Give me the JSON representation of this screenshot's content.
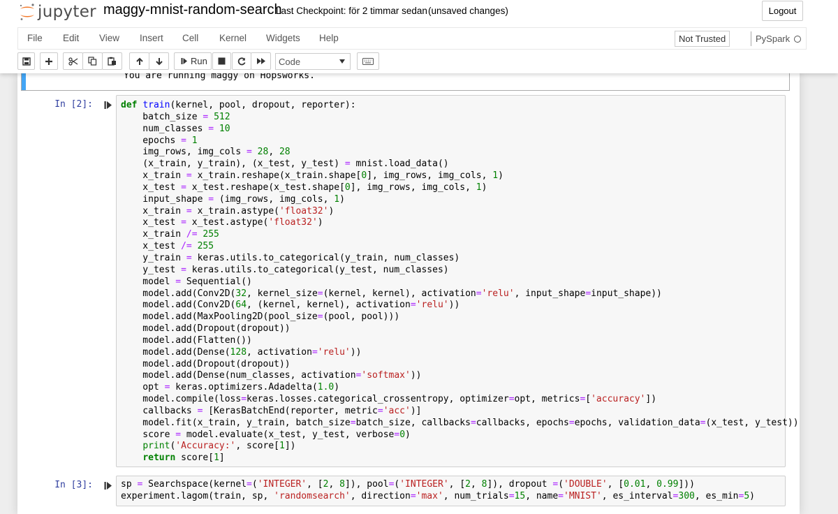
{
  "app": {
    "logo_text": "jupyter",
    "notebook_title": "maggy-mnist-random-search",
    "checkpoint": "Last Checkpoint: för 2 timmar sedan",
    "save_status": "(unsaved changes)",
    "logout_label": "Logout"
  },
  "menu": {
    "items": [
      "File",
      "Edit",
      "View",
      "Insert",
      "Cell",
      "Kernel",
      "Widgets",
      "Help"
    ],
    "trust_label": "Not Trusted",
    "kernel_name": "PySpark"
  },
  "toolbar": {
    "run_label": "Run",
    "cell_type": "Code",
    "icons": [
      "save-icon",
      "plus-icon",
      "cut-icon",
      "copy-icon",
      "paste-icon",
      "arrow-up-icon",
      "arrow-down-icon",
      "step-forward-icon",
      "stop-icon",
      "restart-icon",
      "fast-forward-icon",
      "keyboard-icon"
    ]
  },
  "colors": {
    "prompt": "#303f9f",
    "keyword": "#008000",
    "string": "#ba2121",
    "operator": "#aa22ff",
    "function_name": "#0000ff",
    "selected_cell_bar": "#42a5f5"
  },
  "cells": {
    "prev_output": "You are running maggy on Hopsworks.",
    "cell2": {
      "prompt": "In [2]:",
      "lines": [
        [
          [
            "kw",
            "def"
          ],
          [
            "t",
            " "
          ],
          [
            "fn",
            "train"
          ],
          [
            "t",
            "(kernel, pool, dropout, reporter):"
          ]
        ],
        [
          [
            "t",
            "    batch_size "
          ],
          [
            "op",
            "="
          ],
          [
            "t",
            " "
          ],
          [
            "num",
            "512"
          ]
        ],
        [
          [
            "t",
            "    num_classes "
          ],
          [
            "op",
            "="
          ],
          [
            "t",
            " "
          ],
          [
            "num",
            "10"
          ]
        ],
        [
          [
            "t",
            "    epochs "
          ],
          [
            "op",
            "="
          ],
          [
            "t",
            " "
          ],
          [
            "num",
            "1"
          ]
        ],
        [
          [
            "t",
            "    img_rows, img_cols "
          ],
          [
            "op",
            "="
          ],
          [
            "t",
            " "
          ],
          [
            "num",
            "28"
          ],
          [
            "t",
            ", "
          ],
          [
            "num",
            "28"
          ]
        ],
        [
          [
            "t",
            "    (x_train, y_train), (x_test, y_test) "
          ],
          [
            "op",
            "="
          ],
          [
            "t",
            " mnist.load_data()"
          ]
        ],
        [
          [
            "t",
            "    x_train "
          ],
          [
            "op",
            "="
          ],
          [
            "t",
            " x_train.reshape(x_train.shape["
          ],
          [
            "num",
            "0"
          ],
          [
            "t",
            "], img_rows, img_cols, "
          ],
          [
            "num",
            "1"
          ],
          [
            "t",
            ")"
          ]
        ],
        [
          [
            "t",
            "    x_test "
          ],
          [
            "op",
            "="
          ],
          [
            "t",
            " x_test.reshape(x_test.shape["
          ],
          [
            "num",
            "0"
          ],
          [
            "t",
            "], img_rows, img_cols, "
          ],
          [
            "num",
            "1"
          ],
          [
            "t",
            ")"
          ]
        ],
        [
          [
            "t",
            "    input_shape "
          ],
          [
            "op",
            "="
          ],
          [
            "t",
            " (img_rows, img_cols, "
          ],
          [
            "num",
            "1"
          ],
          [
            "t",
            ")"
          ]
        ],
        [
          [
            "t",
            "    x_train "
          ],
          [
            "op",
            "="
          ],
          [
            "t",
            " x_train.astype("
          ],
          [
            "str",
            "'float32'"
          ],
          [
            "t",
            ")"
          ]
        ],
        [
          [
            "t",
            "    x_test "
          ],
          [
            "op",
            "="
          ],
          [
            "t",
            " x_test.astype("
          ],
          [
            "str",
            "'float32'"
          ],
          [
            "t",
            ")"
          ]
        ],
        [
          [
            "t",
            "    x_train "
          ],
          [
            "op",
            "/="
          ],
          [
            "t",
            " "
          ],
          [
            "num",
            "255"
          ]
        ],
        [
          [
            "t",
            "    x_test "
          ],
          [
            "op",
            "/="
          ],
          [
            "t",
            " "
          ],
          [
            "num",
            "255"
          ]
        ],
        [
          [
            "t",
            "    y_train "
          ],
          [
            "op",
            "="
          ],
          [
            "t",
            " keras.utils.to_categorical(y_train, num_classes)"
          ]
        ],
        [
          [
            "t",
            "    y_test "
          ],
          [
            "op",
            "="
          ],
          [
            "t",
            " keras.utils.to_categorical(y_test, num_classes)"
          ]
        ],
        [
          [
            "t",
            "    model "
          ],
          [
            "op",
            "="
          ],
          [
            "t",
            " Sequential()"
          ]
        ],
        [
          [
            "t",
            "    model.add(Conv2D("
          ],
          [
            "num",
            "32"
          ],
          [
            "t",
            ", kernel_size"
          ],
          [
            "op",
            "="
          ],
          [
            "t",
            "(kernel, kernel), activation"
          ],
          [
            "op",
            "="
          ],
          [
            "str",
            "'relu'"
          ],
          [
            "t",
            ", input_shape"
          ],
          [
            "op",
            "="
          ],
          [
            "t",
            "input_shape))"
          ]
        ],
        [
          [
            "t",
            "    model.add(Conv2D("
          ],
          [
            "num",
            "64"
          ],
          [
            "t",
            ", (kernel, kernel), activation"
          ],
          [
            "op",
            "="
          ],
          [
            "str",
            "'relu'"
          ],
          [
            "t",
            "))"
          ]
        ],
        [
          [
            "t",
            "    model.add(MaxPooling2D(pool_size"
          ],
          [
            "op",
            "="
          ],
          [
            "t",
            "(pool, pool)))"
          ]
        ],
        [
          [
            "t",
            "    model.add(Dropout(dropout))"
          ]
        ],
        [
          [
            "t",
            "    model.add(Flatten())"
          ]
        ],
        [
          [
            "t",
            "    model.add(Dense("
          ],
          [
            "num",
            "128"
          ],
          [
            "t",
            ", activation"
          ],
          [
            "op",
            "="
          ],
          [
            "str",
            "'relu'"
          ],
          [
            "t",
            "))"
          ]
        ],
        [
          [
            "t",
            "    model.add(Dropout(dropout))"
          ]
        ],
        [
          [
            "t",
            "    model.add(Dense(num_classes, activation"
          ],
          [
            "op",
            "="
          ],
          [
            "str",
            "'softmax'"
          ],
          [
            "t",
            "))"
          ]
        ],
        [
          [
            "t",
            "    opt "
          ],
          [
            "op",
            "="
          ],
          [
            "t",
            " keras.optimizers.Adadelta("
          ],
          [
            "num",
            "1.0"
          ],
          [
            "t",
            ")"
          ]
        ],
        [
          [
            "t",
            "    model.compile(loss"
          ],
          [
            "op",
            "="
          ],
          [
            "t",
            "keras.losses.categorical_crossentropy, optimizer"
          ],
          [
            "op",
            "="
          ],
          [
            "t",
            "opt, metrics"
          ],
          [
            "op",
            "="
          ],
          [
            "t",
            "["
          ],
          [
            "str",
            "'accuracy'"
          ],
          [
            "t",
            "])"
          ]
        ],
        [
          [
            "t",
            "    callbacks "
          ],
          [
            "op",
            "="
          ],
          [
            "t",
            " [KerasBatchEnd(reporter, metric"
          ],
          [
            "op",
            "="
          ],
          [
            "str",
            "'acc'"
          ],
          [
            "t",
            ")]"
          ]
        ],
        [
          [
            "t",
            "    model.fit(x_train, y_train, batch_size"
          ],
          [
            "op",
            "="
          ],
          [
            "t",
            "batch_size, callbacks"
          ],
          [
            "op",
            "="
          ],
          [
            "t",
            "callbacks, epochs"
          ],
          [
            "op",
            "="
          ],
          [
            "t",
            "epochs, validation_data"
          ],
          [
            "op",
            "="
          ],
          [
            "t",
            "(x_test, y_test))"
          ]
        ],
        [
          [
            "t",
            "    score "
          ],
          [
            "op",
            "="
          ],
          [
            "t",
            " model.evaluate(x_test, y_test, verbose"
          ],
          [
            "op",
            "="
          ],
          [
            "num",
            "0"
          ],
          [
            "t",
            ")"
          ]
        ],
        [
          [
            "t",
            "    "
          ],
          [
            "bi",
            "print"
          ],
          [
            "t",
            "("
          ],
          [
            "str",
            "'Accuracy:'"
          ],
          [
            "t",
            ", score["
          ],
          [
            "num",
            "1"
          ],
          [
            "t",
            "])"
          ]
        ],
        [
          [
            "t",
            "    "
          ],
          [
            "kw",
            "return"
          ],
          [
            "t",
            " score["
          ],
          [
            "num",
            "1"
          ],
          [
            "t",
            "]"
          ]
        ]
      ]
    },
    "cell3": {
      "prompt": "In [3]:",
      "lines": [
        [
          [
            "t",
            "sp "
          ],
          [
            "op",
            "="
          ],
          [
            "t",
            " Searchspace(kernel"
          ],
          [
            "op",
            "="
          ],
          [
            "t",
            "("
          ],
          [
            "str",
            "'INTEGER'"
          ],
          [
            "t",
            ", ["
          ],
          [
            "num",
            "2"
          ],
          [
            "t",
            ", "
          ],
          [
            "num",
            "8"
          ],
          [
            "t",
            "]), pool"
          ],
          [
            "op",
            "="
          ],
          [
            "t",
            "("
          ],
          [
            "str",
            "'INTEGER'"
          ],
          [
            "t",
            ", ["
          ],
          [
            "num",
            "2"
          ],
          [
            "t",
            ", "
          ],
          [
            "num",
            "8"
          ],
          [
            "t",
            "]), dropout "
          ],
          [
            "op",
            "="
          ],
          [
            "t",
            "("
          ],
          [
            "str",
            "'DOUBLE'"
          ],
          [
            "t",
            ", ["
          ],
          [
            "num",
            "0.01"
          ],
          [
            "t",
            ", "
          ],
          [
            "num",
            "0.99"
          ],
          [
            "t",
            "]))"
          ]
        ],
        [
          [
            "t",
            "experiment.lagom(train, sp, "
          ],
          [
            "str",
            "'randomsearch'"
          ],
          [
            "t",
            ", direction"
          ],
          [
            "op",
            "="
          ],
          [
            "str",
            "'max'"
          ],
          [
            "t",
            ", num_trials"
          ],
          [
            "op",
            "="
          ],
          [
            "num",
            "15"
          ],
          [
            "t",
            ", name"
          ],
          [
            "op",
            "="
          ],
          [
            "str",
            "'MNIST'"
          ],
          [
            "t",
            ", es_interval"
          ],
          [
            "op",
            "="
          ],
          [
            "num",
            "300"
          ],
          [
            "t",
            ", es_min"
          ],
          [
            "op",
            "="
          ],
          [
            "num",
            "5"
          ],
          [
            "t",
            ")"
          ]
        ]
      ]
    }
  }
}
